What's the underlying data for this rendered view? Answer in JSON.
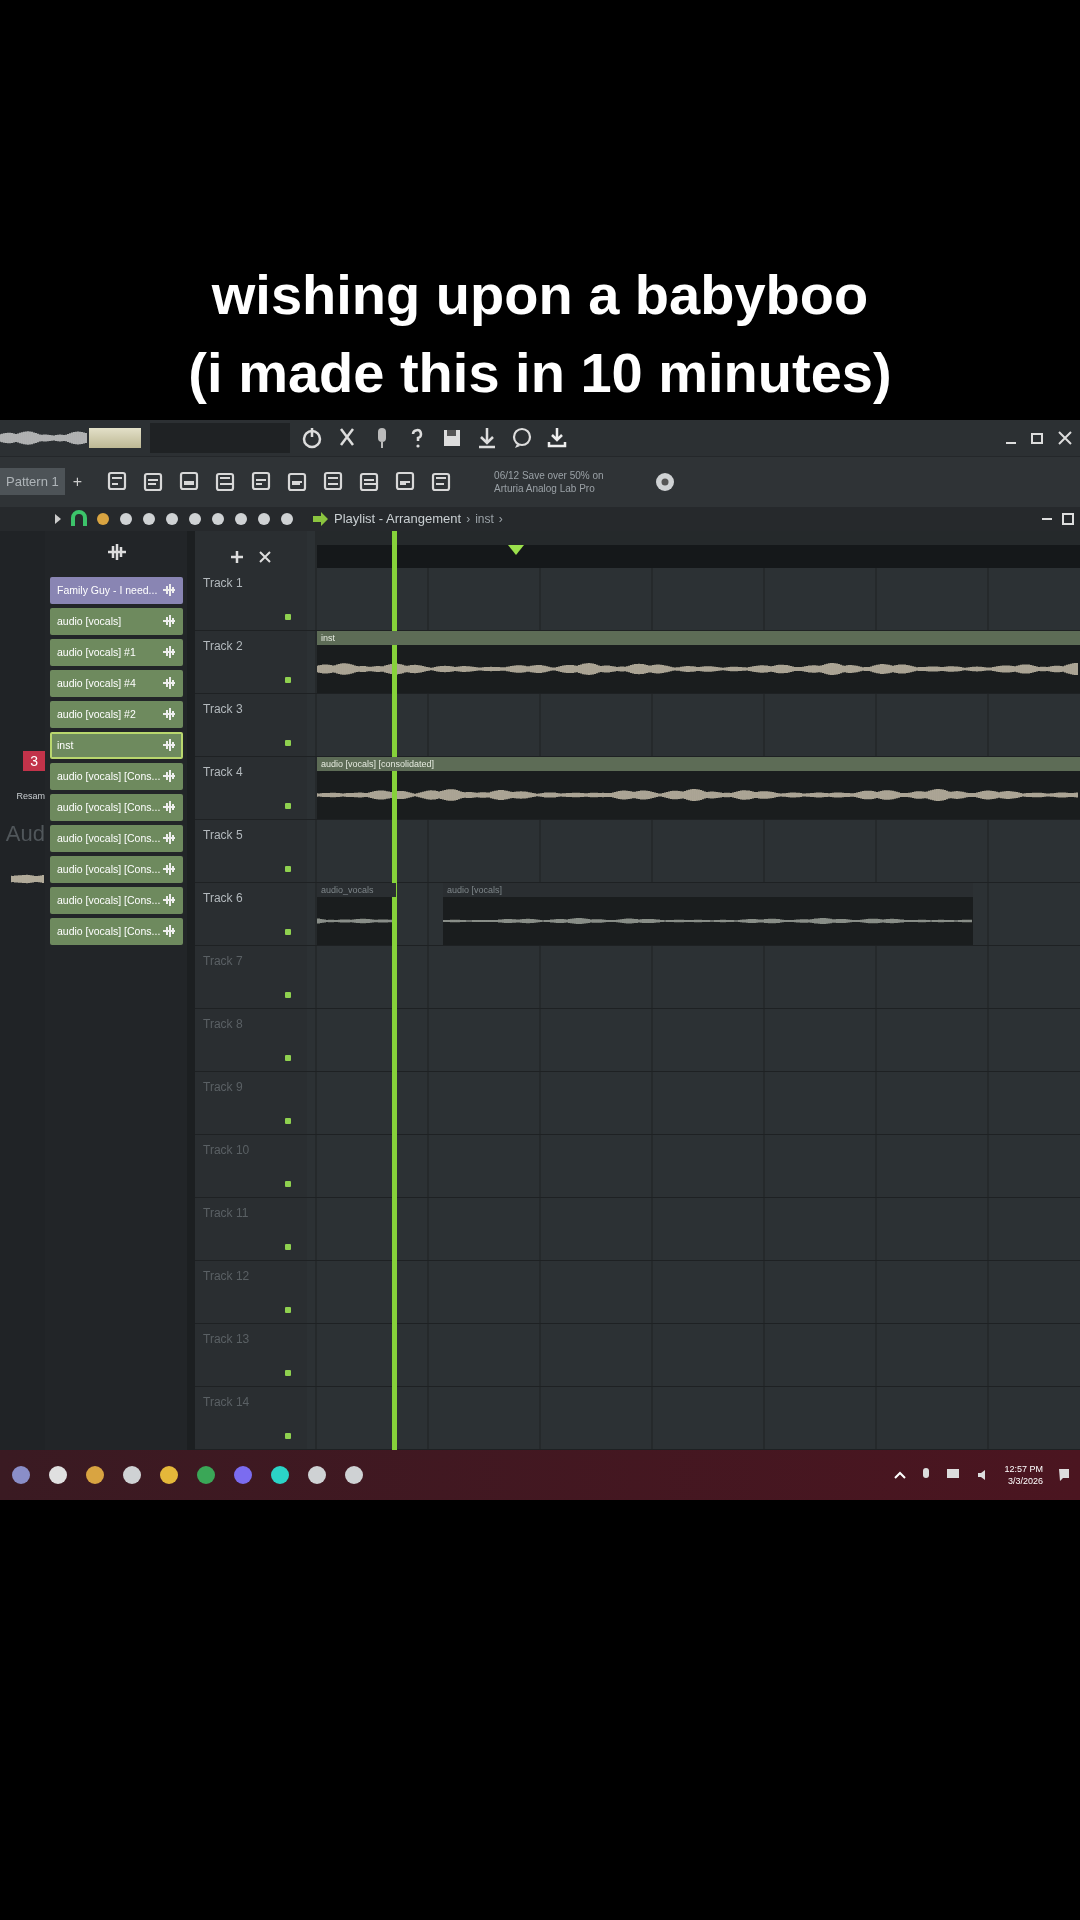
{
  "caption": {
    "lines": [
      "wishing upon a babyboo",
      "(i made this in 10 minutes)"
    ]
  },
  "toolbar": {
    "pattern": "Pattern 1",
    "add": "+",
    "hint_lines": [
      "06/12 Save over 50% on",
      "Arturia Analog Lab Pro"
    ]
  },
  "playlist": {
    "title": "Playlist - Arrangement",
    "crumbs": [
      "›",
      "inst",
      "›"
    ]
  },
  "mixer_strip": {
    "badge": "3",
    "label": "Resam",
    "plugin": "Aud"
  },
  "picker": {
    "items": [
      {
        "label": "Family Guy - I need...",
        "color": "#8985b3",
        "selected": false
      },
      {
        "label": "audio [vocals]",
        "color": "#6e8a5e",
        "selected": false
      },
      {
        "label": "audio [vocals] #1",
        "color": "#6e8a5e",
        "selected": false
      },
      {
        "label": "audio [vocals] #4",
        "color": "#6e8a5e",
        "selected": false
      },
      {
        "label": "audio [vocals] #2",
        "color": "#6e8a5e",
        "selected": false
      },
      {
        "label": "inst",
        "color": "#6e8a5e",
        "selected": true
      },
      {
        "label": "audio [vocals] [Cons...",
        "color": "#6e8a5e",
        "selected": false
      },
      {
        "label": "audio [vocals] [Cons...",
        "color": "#6e8a5e",
        "selected": false
      },
      {
        "label": "audio [vocals] [Cons...",
        "color": "#6e8a5e",
        "selected": false
      },
      {
        "label": "audio [vocals] [Cons...",
        "color": "#6e8a5e",
        "selected": false
      },
      {
        "label": "audio [vocals] [Cons...",
        "color": "#6e8a5e",
        "selected": false
      },
      {
        "label": "audio [vocals] [Cons...",
        "color": "#6e8a5e",
        "selected": false
      }
    ]
  },
  "tracks": [
    {
      "name": "Track 1",
      "enabled": true
    },
    {
      "name": "Track 2",
      "enabled": true,
      "clips": [
        {
          "label": "inst",
          "kind": "full"
        }
      ]
    },
    {
      "name": "Track 3",
      "enabled": true
    },
    {
      "name": "Track 4",
      "enabled": true,
      "clips": [
        {
          "label": "audio [vocals] [consolidated]",
          "kind": "full"
        }
      ]
    },
    {
      "name": "Track 5",
      "enabled": true
    },
    {
      "name": "Track 6",
      "enabled": true,
      "clips": [
        {
          "label": "audio_vocals",
          "kind": "faded"
        },
        {
          "label": "audio [vocals]",
          "kind": "faded"
        }
      ]
    },
    {
      "name": "Track 7",
      "enabled": true
    },
    {
      "name": "Track 8",
      "enabled": true
    },
    {
      "name": "Track 9",
      "enabled": true
    },
    {
      "name": "Track 10",
      "enabled": true
    },
    {
      "name": "Track 11",
      "enabled": true
    },
    {
      "name": "Track 12",
      "enabled": true
    },
    {
      "name": "Track 13",
      "enabled": true
    },
    {
      "name": "Track 14",
      "enabled": true
    }
  ],
  "taskbar": {
    "time": "12:57 PM",
    "date": "3/3/2026"
  }
}
